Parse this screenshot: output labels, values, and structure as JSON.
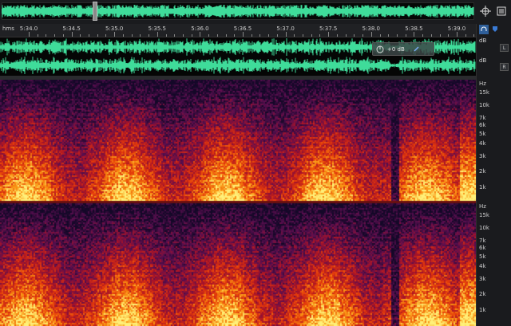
{
  "overview": {
    "label": "Overview"
  },
  "ruler": {
    "units": "hms",
    "ticks": [
      "5:34.0",
      "5:34.5",
      "5:35.0",
      "5:35.5",
      "5:36.0",
      "5:36.5",
      "5:37.0",
      "5:37.5",
      "5:38.0",
      "5:38.5",
      "5:39.0"
    ]
  },
  "hud": {
    "gain": "+0 dB"
  },
  "waveform_scale": {
    "unit_top": "dB",
    "unit_bottom": "dB",
    "ch_left": "L",
    "ch_right": "R"
  },
  "spectral_scale": {
    "top": {
      "unit": "Hz",
      "labels": [
        "15k",
        "10k",
        "7k",
        "6k",
        "5k",
        "4k",
        "3k",
        "2k",
        "1k"
      ]
    },
    "bottom": {
      "unit": "Hz",
      "labels": [
        "15k",
        "10k",
        "7k",
        "6k",
        "5k",
        "4k",
        "3k",
        "2k",
        "1k"
      ]
    }
  },
  "colors": {
    "waveform": "#3fdc9a",
    "background": "#0d0d0f"
  }
}
